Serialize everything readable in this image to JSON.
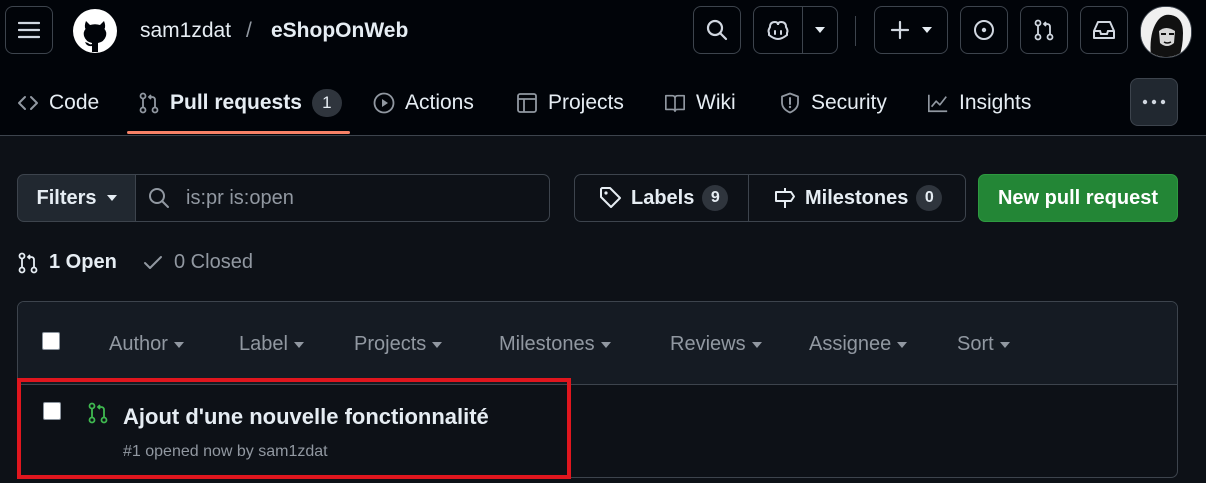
{
  "header": {
    "owner": "sam1zdat",
    "separator": "/",
    "repo": "eShopOnWeb"
  },
  "tabs": [
    {
      "label": "Code",
      "icon": "code-icon"
    },
    {
      "label": "Pull requests",
      "icon": "git-pull-request-icon",
      "count": "1"
    },
    {
      "label": "Actions",
      "icon": "play-icon"
    },
    {
      "label": "Projects",
      "icon": "table-icon"
    },
    {
      "label": "Wiki",
      "icon": "book-icon"
    },
    {
      "label": "Security",
      "icon": "shield-icon"
    },
    {
      "label": "Insights",
      "icon": "graph-icon"
    }
  ],
  "toolbar": {
    "filters_label": "Filters",
    "search_placeholder": "is:pr is:open",
    "labels_label": "Labels",
    "labels_count": "9",
    "milestones_label": "Milestones",
    "milestones_count": "0",
    "new_pr_label": "New pull request"
  },
  "state": {
    "open_label": "1 Open",
    "closed_label": "0 Closed"
  },
  "list_header": {
    "author": "Author",
    "label": "Label",
    "projects": "Projects",
    "milestones": "Milestones",
    "reviews": "Reviews",
    "assignee": "Assignee",
    "sort": "Sort"
  },
  "pull_requests": [
    {
      "title": "Ajout d'une nouvelle fonctionnalité",
      "meta": "#1 opened now by sam1zdat"
    }
  ],
  "colors": {
    "background": "#0d1117",
    "topbar": "#010409",
    "accent_underline": "#f78166",
    "primary_button": "#238636",
    "open_pr_icon": "#3fb950",
    "highlight_box": "#e0161e"
  }
}
